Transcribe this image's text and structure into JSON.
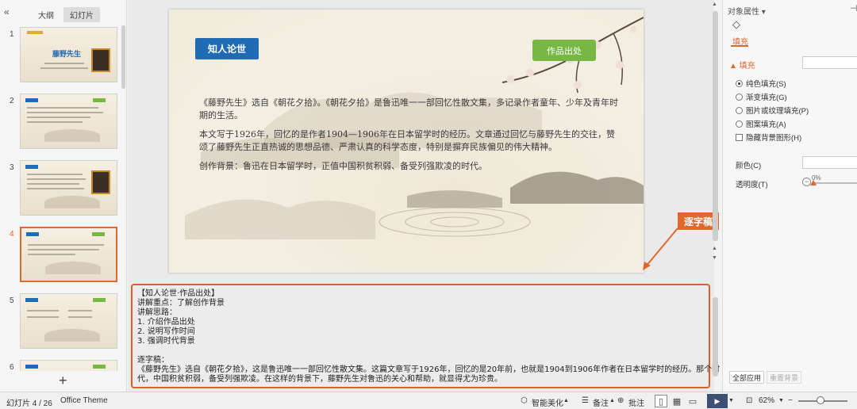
{
  "left_panel": {
    "collapse_icon": "«",
    "tabs": [
      "大纲",
      "幻灯片"
    ],
    "active_tab": "幻灯片",
    "slide_numbers": [
      "1",
      "2",
      "3",
      "4",
      "5",
      "6"
    ],
    "current_slide": "4",
    "thumb1_title": "藤野先生",
    "add_icon": "+"
  },
  "slide": {
    "title_badge": "知人论世",
    "source_badge": "作品出处",
    "para1": "《藤野先生》选自《朝花夕拾》。《朝花夕拾》是鲁迅唯一一部回忆性散文集，多记录作者童年、少年及青年时期的生活。",
    "para2": "本文写于1926年，回忆的是作者1904—1906年在日本留学时的经历。文章通过回忆与藤野先生的交往，赞颂了藤野先生正直热诚的思想品德、严肃认真的科学态度，特别是摒弃民族偏见的伟大精神。",
    "para3": "创作背景：鲁迅在日本留学时，正值中国积贫积弱、备受列强欺凌的时代。"
  },
  "callout": "逐字稿",
  "notes": {
    "lines": [
      "【知人论世·作品出处】",
      "讲解重点：了解创作背景",
      "讲解思路：",
      "1. 介绍作品出处",
      "2. 说明写作时间",
      "3. 强调时代背景",
      "",
      "逐字稿：",
      "《藤野先生》选自《朝花夕拾》，这是鲁迅唯一一部回忆性散文集。这篇文章写于1926年，回忆的是20年前，也就是1904到1906年作者在日本留学时的经历。那个时",
      "代，中国积贫积弱，备受列强欺凌。在这样的背景下，藤野先生对鲁迅的关心和帮助，就显得尤为珍贵。"
    ]
  },
  "right_panel": {
    "title": "对象属性 ▾",
    "pin_icon": "⊣",
    "fill_tab": "填充",
    "fill_section": "▲ 填充",
    "options": [
      "纯色填充(S)",
      "渐变填充(G)",
      "图片或纹理填充(P)",
      "图案填充(A)"
    ],
    "hide_bg_graphics": "隐藏背景图形(H)",
    "color_label": "颜色(C)",
    "opacity_label": "透明度(T)",
    "opacity_value": "0%",
    "opacity_fraction": 0,
    "apply_all": "全部应用",
    "reset_bg": "重置背景"
  },
  "status_bar": {
    "slide_counter": "幻灯片 4 / 26",
    "theme": "Office Theme",
    "smart_beautify": "智能美化",
    "notes": "备注",
    "comments": "批注",
    "zoom": "62%",
    "zoom_fraction": 0.42,
    "colors": {
      "accent": "#e0682d",
      "blue_badge": "#1f6bb4",
      "green_badge": "#76b843"
    }
  }
}
